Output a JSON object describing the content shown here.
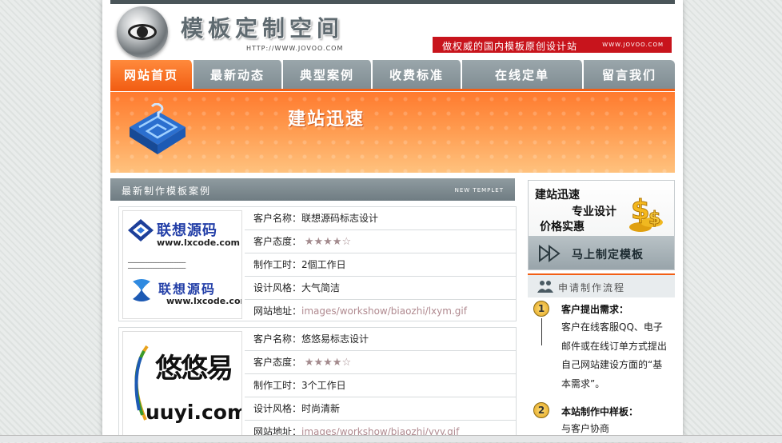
{
  "header": {
    "title": "模板定制空间",
    "url": "HTTP://WWW.JOVOO.COM",
    "slogan": "做权威的国内模板原创设计站",
    "slogan_url": "WWW.JOVOO.COM"
  },
  "nav": {
    "tabs": [
      {
        "label": "网站首页",
        "active": true
      },
      {
        "label": "最新动态",
        "active": false
      },
      {
        "label": "典型案例",
        "active": false
      },
      {
        "label": "收费标准",
        "active": false
      },
      {
        "label": "在线定单",
        "active": false
      },
      {
        "label": "留言我们",
        "active": false
      }
    ]
  },
  "banner": {
    "text": "建站迅速"
  },
  "section": {
    "title": "最新制作模板案例",
    "tag": "NEW TEMPLET"
  },
  "cases": [
    {
      "thumb": {
        "name": "联想源码",
        "url": "www.lxcode.com"
      },
      "rows": [
        {
          "label": "客户名称：",
          "value": "联想源码标志设计"
        },
        {
          "label": "客户态度：",
          "value": "★★★★☆"
        },
        {
          "label": "制作工时：",
          "value": "2個工作日"
        },
        {
          "label": "设计风格：",
          "value": "大气简洁"
        },
        {
          "label": "网站地址：",
          "value": "images/workshow/biaozhi/lxym.gif"
        }
      ]
    },
    {
      "thumb": {
        "name": "悠悠易",
        "url": "uuyi.com"
      },
      "rows": [
        {
          "label": "客户名称：",
          "value": "悠悠易标志设计"
        },
        {
          "label": "客户态度：",
          "value": "★★★★☆"
        },
        {
          "label": "制作工时：",
          "value": "3个工作日"
        },
        {
          "label": "设计风格：",
          "value": "时尚清新"
        },
        {
          "label": "网站地址：",
          "value": "images/workshow/biaozhi/yyy.gif"
        }
      ]
    }
  ],
  "promo": {
    "line1": "建站迅速",
    "line2": "专业设计",
    "line3": "价格实惠",
    "button": "马上制定模板"
  },
  "flow": {
    "title": "申请制作流程",
    "steps": [
      {
        "num": "1",
        "title": "客户提出需求：",
        "body": "客户在线客服QQ、电子邮件或在线订单方式提出自己网站建设方面的“基本需求”。"
      },
      {
        "num": "2",
        "title": "本站制作中样板：",
        "body": "与客户协商"
      }
    ]
  },
  "colors": {
    "accent": "#f25e14",
    "nav_gray": "#8a969c",
    "slogan_red": "#c8141c",
    "link": "#b08a90"
  }
}
